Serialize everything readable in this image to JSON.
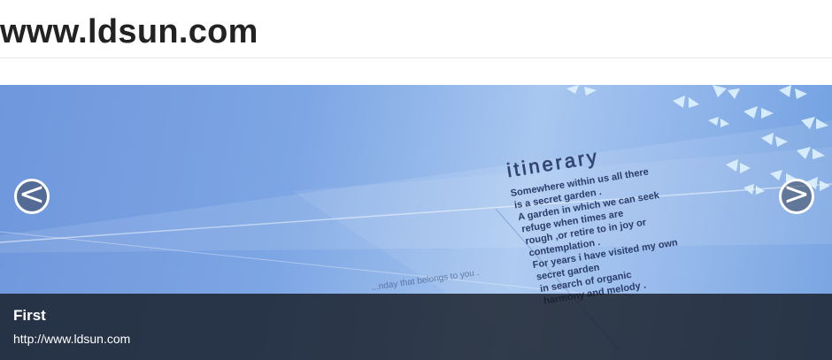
{
  "header": {
    "site_title": "www.ldsun.com"
  },
  "carousel": {
    "slide": {
      "heading": "itinerary",
      "poem_lines": [
        "Somewhere within us all there",
        "is a secret garden .",
        "A garden in which we can seek",
        "refuge when times are",
        "rough ,or retire to in joy or",
        "contemplation .",
        "For years i have visited my own",
        "secret garden",
        "in search of organic",
        "harmony and melody ."
      ],
      "faint_text": "...nday that belongs to you ."
    },
    "prev_symbol": "<",
    "next_symbol": ">",
    "caption": {
      "title": "First",
      "text": "http://www.ldsun.com"
    }
  }
}
